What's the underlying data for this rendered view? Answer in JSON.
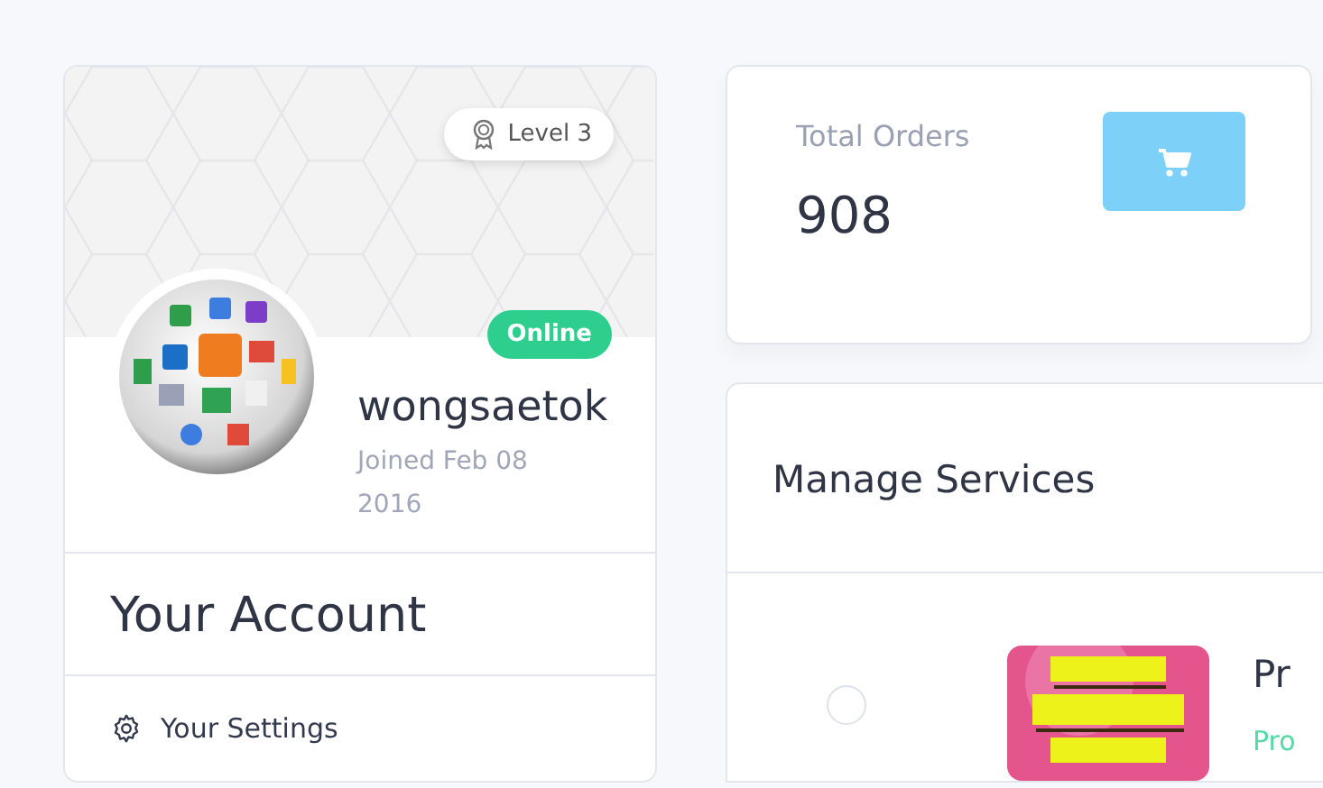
{
  "profile": {
    "level_badge": "Level 3",
    "status": "Online",
    "online": true,
    "username": "wongsaetok",
    "joined": "Joined Feb 08 2016"
  },
  "account": {
    "title": "Your Account",
    "menu": [
      {
        "label": "Your Settings"
      }
    ]
  },
  "stats": {
    "label": "Total Orders",
    "value": "908"
  },
  "services": {
    "title": "Manage Services",
    "rows": [
      {
        "selected": false,
        "name": "Pr",
        "status": "Pro"
      }
    ]
  }
}
